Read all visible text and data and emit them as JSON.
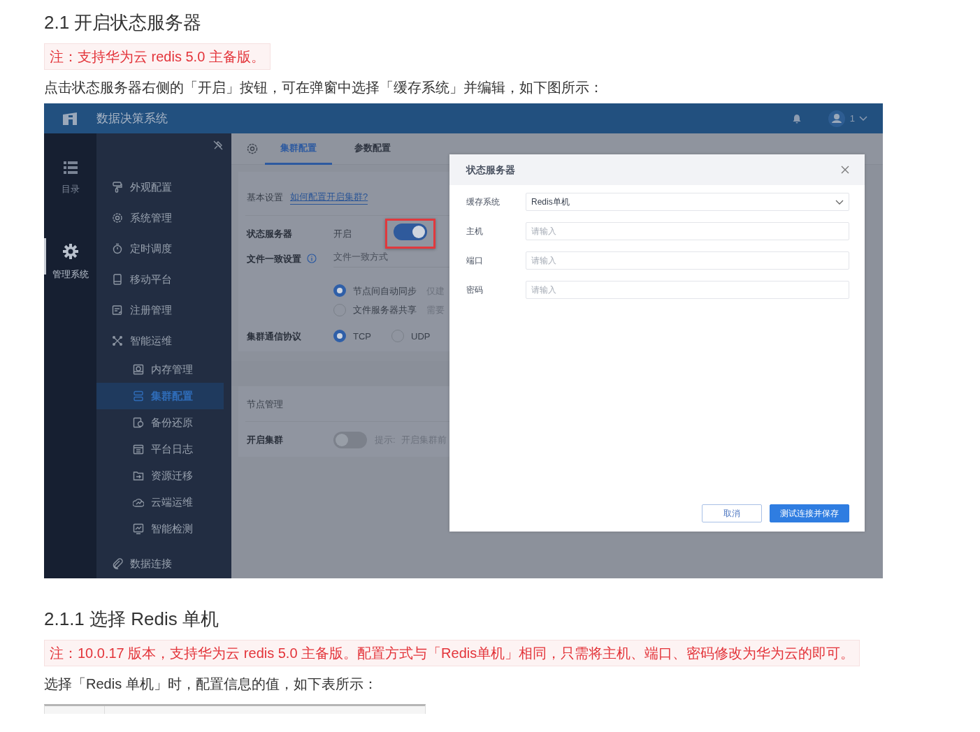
{
  "doc": {
    "heading": "2.1 开启状态服务器",
    "note": "注：支持华为云 redis 5.0 主备版。",
    "paragraph": "点击状态服务器右侧的「开启」按钮，可在弹窗中选择「缓存系统」并编辑，如下图所示："
  },
  "app": {
    "title": "数据决策系统",
    "user": "1",
    "rail": [
      {
        "label": "目录",
        "selected": false
      },
      {
        "label": "管理系统",
        "selected": true
      }
    ],
    "menu": [
      {
        "label": "外观配置",
        "selected": false
      },
      {
        "label": "系统管理",
        "selected": false
      },
      {
        "label": "定时调度",
        "selected": false
      },
      {
        "label": "移动平台",
        "selected": false
      },
      {
        "label": "注册管理",
        "selected": false
      },
      {
        "label": "智能运维",
        "selected": false,
        "children": [
          {
            "label": "内存管理",
            "selected": false
          },
          {
            "label": "集群配置",
            "selected": true
          },
          {
            "label": "备份还原",
            "selected": false
          },
          {
            "label": "平台日志",
            "selected": false
          },
          {
            "label": "资源迁移",
            "selected": false
          },
          {
            "label": "云端运维",
            "selected": false
          },
          {
            "label": "智能检测",
            "selected": false
          }
        ]
      },
      {
        "label": "数据连接",
        "selected": false
      }
    ],
    "tabs": [
      {
        "label": "集群配置",
        "selected": true
      },
      {
        "label": "参数配置",
        "selected": false
      }
    ],
    "basic": {
      "label": "基本设置",
      "link": "如何配置开启集群?"
    },
    "state_server": {
      "label": "状态服务器",
      "value": "开启",
      "on": true,
      "highlighted": true
    },
    "file_sync": {
      "label": "文件一致设置",
      "placeholder": "文件一致方式",
      "options": [
        {
          "label": "节点间自动同步",
          "hint": "仅建",
          "selected": true
        },
        {
          "label": "文件服务器共享",
          "hint": "需要",
          "selected": false
        }
      ]
    },
    "protocol": {
      "label": "集群通信协议",
      "options": [
        {
          "label": "TCP",
          "selected": true
        },
        {
          "label": "UDP",
          "selected": false
        }
      ]
    },
    "node": {
      "title": "节点管理",
      "label": "开启集群",
      "on": false,
      "hint": "提示:",
      "hint_text": "开启集群前"
    },
    "dialog": {
      "title": "状态服务器",
      "fields": [
        {
          "kind": "select",
          "label": "缓存系统",
          "value": "Redis单机"
        },
        {
          "kind": "input",
          "label": "主机",
          "placeholder": "请输入"
        },
        {
          "kind": "input",
          "label": "端口",
          "placeholder": "请输入"
        },
        {
          "kind": "input",
          "label": "密码",
          "placeholder": "请输入"
        }
      ],
      "buttons": [
        {
          "label": "取消",
          "kind": "secondary"
        },
        {
          "label": "测试连接并保存",
          "kind": "primary"
        }
      ]
    }
  },
  "doc2": {
    "heading": "2.1.1 选择 Redis 单机",
    "note": "注：10.0.17 版本，支持华为云 redis 5.0 主备版。配置方式与「Redis单机」相同，只需将主机、端口、密码修改为华为云的即可。",
    "paragraph": "选择「Redis 单机」时，配置信息的值，如下表所示："
  }
}
